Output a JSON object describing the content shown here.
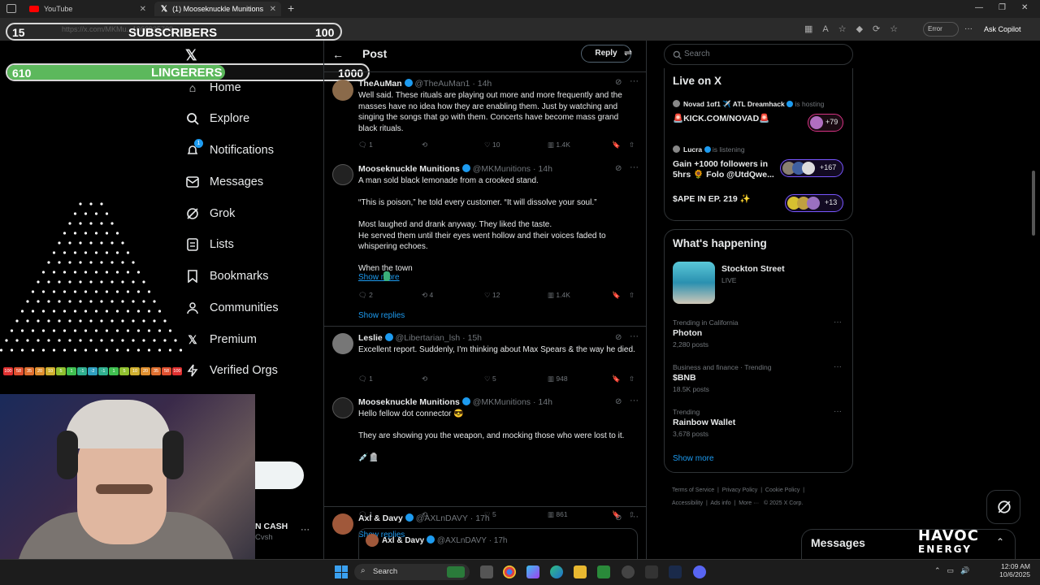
{
  "browser": {
    "tabs": [
      {
        "label": "YouTube"
      },
      {
        "label": "(1) Mooseknuckle Munitions on X"
      }
    ],
    "url": "https://x.com/MKMu...1060935709",
    "error_label": "Error",
    "copilot_label": "Ask Copilot"
  },
  "overlay": {
    "subscribers": {
      "current": "15",
      "label": "SUBSCRIBERS",
      "goal": "100"
    },
    "lingerers": {
      "current": "610",
      "label": "LINGERERS",
      "goal": "1000",
      "progress": 0.61
    },
    "plinko_scores": [
      "100",
      "58",
      "35",
      "20",
      "10",
      "5",
      "1",
      "-1",
      "-2",
      "-1",
      "1",
      "5",
      "10",
      "20",
      "35",
      "58",
      "100"
    ]
  },
  "nav": {
    "items": [
      {
        "label": "Home",
        "icon": "home-icon"
      },
      {
        "label": "Explore",
        "icon": "search-icon"
      },
      {
        "label": "Notifications",
        "icon": "bell-icon",
        "badge": "1"
      },
      {
        "label": "Messages",
        "icon": "mail-icon"
      },
      {
        "label": "Grok",
        "icon": "grok-icon"
      },
      {
        "label": "Lists",
        "icon": "list-icon"
      },
      {
        "label": "Bookmarks",
        "icon": "bookmark-icon"
      },
      {
        "label": "Communities",
        "icon": "people-icon"
      },
      {
        "label": "Premium",
        "icon": "x-icon"
      },
      {
        "label": "Verified Orgs",
        "icon": "lightning-icon"
      }
    ],
    "account_name": "N CASH",
    "account_handle": "Cvsh"
  },
  "header": {
    "title": "Post",
    "reply_button": "Reply"
  },
  "posts": [
    {
      "name": "TheAuMan",
      "handle": "@TheAuMan1",
      "time": "· 14h",
      "text": "Well said.  These rituals are playing out more and more frequently and the masses have no idea how they are enabling them.  Just by watching and singing the songs that go with them.  Concerts have become mass grand black rituals.",
      "replies": "1",
      "reposts": "",
      "likes": "10",
      "views": "1.4K"
    },
    {
      "name": "Mooseknuckle Munitions",
      "handle": "@MKMunitions",
      "time": "· 14h",
      "text": "A man sold black lemonade from a crooked stand.\n\n“This is poison,” he told every customer. “It will dissolve your soul.”\n\nMost laughed and drank anyway. They liked the taste.\nHe served them until their eyes went hollow and their voices faded to whispering echoes.\n\nWhen the town",
      "show_more": "Show more",
      "replies": "2",
      "reposts": "4",
      "likes": "12",
      "views": "1.4K",
      "show_replies": "Show replies"
    },
    {
      "name": "Leslie",
      "handle": "@Libertarian_lsh",
      "time": "· 15h",
      "text": "Excellent report. Suddenly, I'm thinking about Max Spears & the way he died.",
      "replies": "1",
      "reposts": "",
      "likes": "5",
      "views": "948"
    },
    {
      "name": "Mooseknuckle Munitions",
      "handle": "@MKMunitions",
      "time": "· 14h",
      "text": "Hello fellow dot connector 😎\n\nThey are showing you the weapon, and mocking those who were lost to it.\n\n💉🪦",
      "replies": "1",
      "reposts": "",
      "likes": "5",
      "views": "861",
      "show_replies": "Show replies"
    },
    {
      "name": "Axl & Davy",
      "handle": "@AXLnDAVY",
      "time": "· 17h",
      "quote_name": "Axl & Davy",
      "quote_handle": "@AXLnDAVY",
      "quote_time": "· 17h"
    }
  ],
  "search": {
    "placeholder": "Search"
  },
  "live": {
    "title": "Live on X",
    "items": [
      {
        "host": "Novad 1ɑf1 ✈️ ATL Dreamhack",
        "status": "is hosting",
        "title": "🚨KICK.COM/NOVAD🚨",
        "count": "+79"
      },
      {
        "host": "Lucra",
        "status": "is listening",
        "title": "Gain +1000 followers in 5hrs 🌻 Folo @UtdQwe...",
        "count": "+167"
      },
      {
        "host": "",
        "status": "",
        "title": "$APE IN EP. 219 ✨",
        "count": "+13"
      }
    ]
  },
  "happening": {
    "title": "What's happening",
    "featured": {
      "title": "Stockton Street",
      "status": "LIVE"
    },
    "trends": [
      {
        "context": "Trending in California",
        "name": "Photon",
        "posts": "2,280 posts"
      },
      {
        "context": "Business and finance · Trending",
        "name": "$BNB",
        "posts": "18.5K posts"
      },
      {
        "context": "Trending",
        "name": "Rainbow Wallet",
        "posts": "3,678 posts"
      }
    ],
    "show_more": "Show more"
  },
  "footer": {
    "links": [
      "Terms of Service",
      "Privacy Policy",
      "Cookie Policy",
      "Accessibility",
      "Ads info",
      "More ···",
      "© 2025 X Corp."
    ]
  },
  "messages_drawer": {
    "label": "Messages"
  },
  "brand": {
    "line1": "HAVOC",
    "line2": "ENERGY"
  },
  "taskbar": {
    "search_label": "Search",
    "time": "12:09 AM",
    "date": "10/6/2025"
  }
}
